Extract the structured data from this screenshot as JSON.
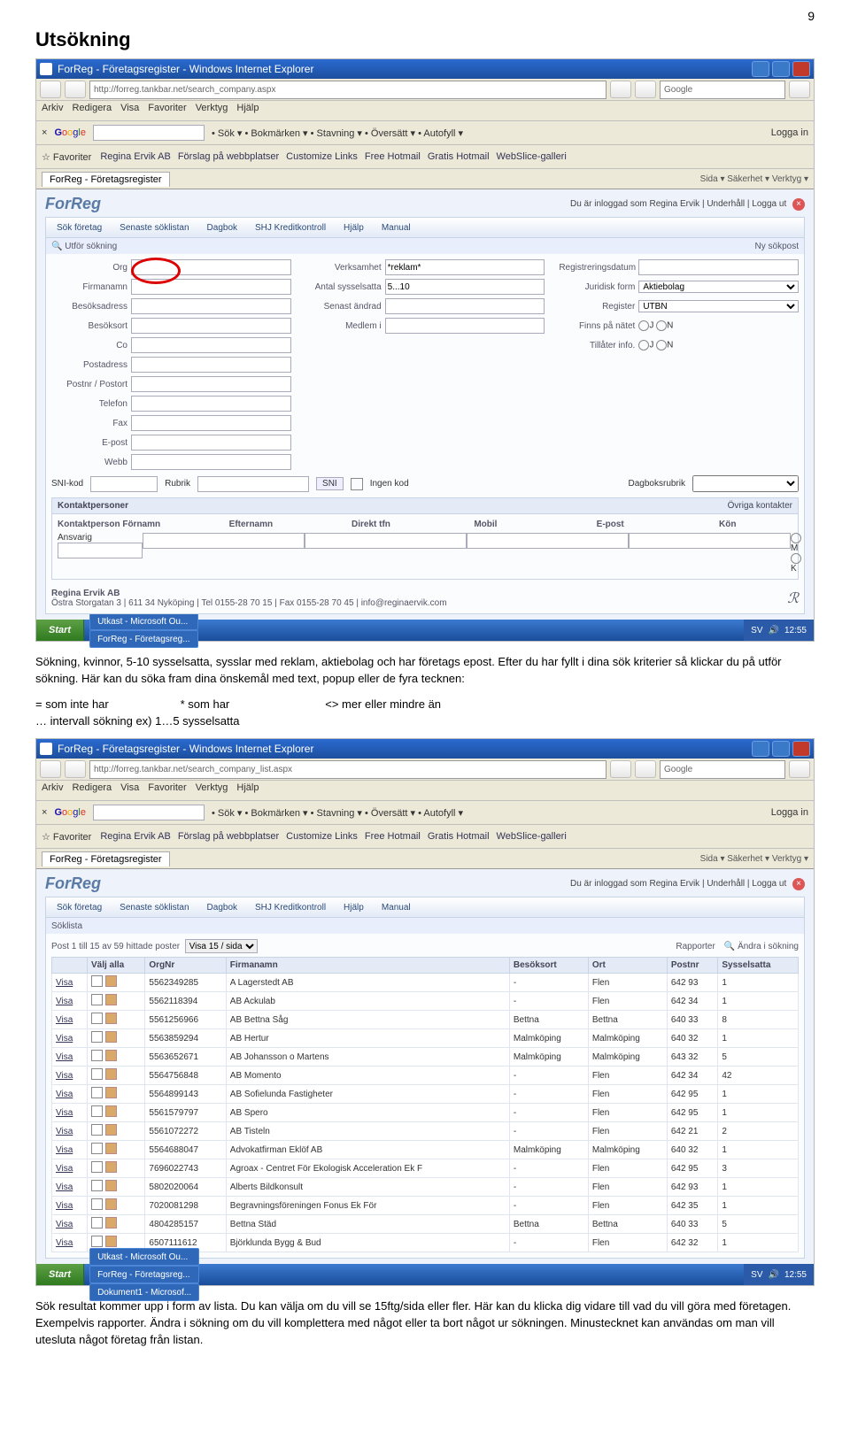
{
  "pageNumber": "9",
  "heading": "Utsökning",
  "para1": "Sökning, kvinnor, 5-10 sysselsatta, sysslar med reklam, aktiebolag och har företags epost. Efter du har fyllt i dina sök kriterier så klickar du på utför sökning. Här kan du söka fram dina önskemål med text, popup eller de fyra tecknen:",
  "opsLine1a": "= som inte har",
  "opsLine1b": "* som har",
  "opsLine1c": "<> mer eller mindre än",
  "opsLine2": "… intervall sökning ex) 1…5 sysselsatta",
  "para2": "Sök resultat kommer upp i form av lista. Du kan välja om du vill se 15ftg/sida eller fler. Här kan du klicka dig vidare till vad du vill göra med företagen. Exempelvis rapporter. Ändra i sökning om du vill komplettera med något eller ta bort något ur sökningen. Minustecknet kan användas om man vill utesluta något företag från listan.",
  "ie": {
    "title": "ForReg - Företagsregister - Windows Internet Explorer",
    "url1": "http://forreg.tankbar.net/search_company.aspx",
    "url2": "http://forreg.tankbar.net/search_company_list.aspx",
    "searchEngine": "Google",
    "menus": [
      "Arkiv",
      "Redigera",
      "Visa",
      "Favoriter",
      "Verktyg",
      "Hjälp"
    ],
    "googleItems": [
      "Sök",
      "Bokmärken",
      "Stavning",
      "Översätt",
      "Autofyll"
    ],
    "login": "Logga in",
    "favLabel": "Favoriter",
    "favLinks": [
      "Regina Ervik AB",
      "Förslag på webbplatser",
      "Customize Links",
      "Free Hotmail",
      "Gratis Hotmail",
      "WebSlice-galleri"
    ],
    "tabTitle": "ForReg - Företagsregister",
    "ieTools": "Sida ▾   Säkerhet ▾   Verktyg ▾"
  },
  "fr": {
    "logo": "ForReg",
    "loggedIn": "Du är inloggad som Regina Ervik  |  Underhåll  |  Logga ut",
    "tabs": [
      "Sök företag",
      "Senaste söklistan",
      "Dagbok",
      "SHJ Kreditkontroll",
      "Hjälp",
      "Manual"
    ],
    "utfor": "Utför sökning",
    "nysokpost": "Ny sökpost",
    "left": [
      "Org",
      "Firmanamn",
      "Besöksadress",
      "Besöksort",
      "Co",
      "Postadress",
      "Postnr / Postort",
      "Telefon",
      "Fax",
      "E-post",
      "Webb"
    ],
    "mid": {
      "verksamhet": {
        "label": "Verksamhet",
        "value": "*reklam*"
      },
      "antal": {
        "label": "Antal sysselsatta",
        "value": "5...10"
      },
      "senast": "Senast ändrad",
      "medlem": "Medlem i"
    },
    "right": {
      "regdatum": "Registreringsdatum",
      "juridisk": {
        "label": "Juridisk form",
        "value": "Aktiebolag"
      },
      "register": {
        "label": "Register",
        "value": "UTBN"
      },
      "finns": "Finns på nätet",
      "tillater": "Tillåter info.",
      "J": "J",
      "N": "N"
    },
    "sni": {
      "sni": "SNI-kod",
      "rubrik": "Rubrik",
      "sniBtn": "SNI",
      "ingenKod": "Ingen kod",
      "dagbok": "Dagboksrubrik"
    },
    "kontakt": {
      "title": "Kontaktpersoner",
      "ovriga": "Övriga kontakter",
      "cols": [
        "Kontaktperson Förnamn",
        "Efternamn",
        "Direkt tfn",
        "Mobil",
        "E-post",
        "Kön"
      ],
      "ansvarig": "Ansvarig",
      "M": "M",
      "K": "K"
    },
    "footer": "Regina Ervik AB",
    "footer2": "Östra Storgatan 3 | 611 34 Nyköping | Tel 0155-28 70 15 | Fax 0155-28 70 45 | info@reginaervik.com",
    "monogram": "R",
    "monoSub": "Regina Ervik AB"
  },
  "taskbar": {
    "start": "Start",
    "items1": [
      "Utkast - Microsoft Ou...",
      "ForReg - Företagsreg..."
    ],
    "items2": [
      "Utkast - Microsoft Ou...",
      "ForReg - Företagsreg...",
      "Dokument1 - Microsof..."
    ],
    "lang": "SV",
    "time": "12:55"
  },
  "shot2": {
    "soklista": "Söklista",
    "pager": "Post 1 till 15 av 59 hittade poster",
    "perPage": "Visa 15 / sida",
    "rapporter": "Rapporter",
    "andra": "Ändra i sökning",
    "headers": [
      "",
      "Välj alla",
      "OrgNr",
      "Firmanamn",
      "Besöksort",
      "Ort",
      "Postnr",
      "Sysselsatta"
    ],
    "rows": [
      [
        "Visa",
        "5562349285",
        "A Lagerstedt AB",
        "-",
        "Flen",
        "642 93",
        "1"
      ],
      [
        "Visa",
        "5562118394",
        "AB Ackulab",
        "-",
        "Flen",
        "642 34",
        "1"
      ],
      [
        "Visa",
        "5561256966",
        "AB Bettna Såg",
        "Bettna",
        "Bettna",
        "640 33",
        "8"
      ],
      [
        "Visa",
        "5563859294",
        "AB Hertur",
        "Malmköping",
        "Malmköping",
        "640 32",
        "1"
      ],
      [
        "Visa",
        "5563652671",
        "AB Johansson o Martens",
        "Malmköping",
        "Malmköping",
        "643 32",
        "5"
      ],
      [
        "Visa",
        "5564756848",
        "AB Momento",
        "-",
        "Flen",
        "642 34",
        "42"
      ],
      [
        "Visa",
        "5564899143",
        "AB Sofielunda Fastigheter",
        "-",
        "Flen",
        "642 95",
        "1"
      ],
      [
        "Visa",
        "5561579797",
        "AB Spero",
        "-",
        "Flen",
        "642 95",
        "1"
      ],
      [
        "Visa",
        "5561072272",
        "AB Tisteln",
        "-",
        "Flen",
        "642 21",
        "2"
      ],
      [
        "Visa",
        "5564688047",
        "Advokatfirman Eklöf AB",
        "Malmköping",
        "Malmköping",
        "640 32",
        "1"
      ],
      [
        "Visa",
        "7696022743",
        "Agroax - Centret För Ekologisk Acceleration Ek F",
        "-",
        "Flen",
        "642 95",
        "3"
      ],
      [
        "Visa",
        "5802020064",
        "Alberts Bildkonsult",
        "-",
        "Flen",
        "642 93",
        "1"
      ],
      [
        "Visa",
        "7020081298",
        "Begravningsföreningen Fonus Ek För",
        "-",
        "Flen",
        "642 35",
        "1"
      ],
      [
        "Visa",
        "4804285157",
        "Bettna Städ",
        "Bettna",
        "Bettna",
        "640 33",
        "5"
      ],
      [
        "Visa",
        "6507111612",
        "Björklunda Bygg & Bud",
        "-",
        "Flen",
        "642 32",
        "1"
      ]
    ]
  }
}
